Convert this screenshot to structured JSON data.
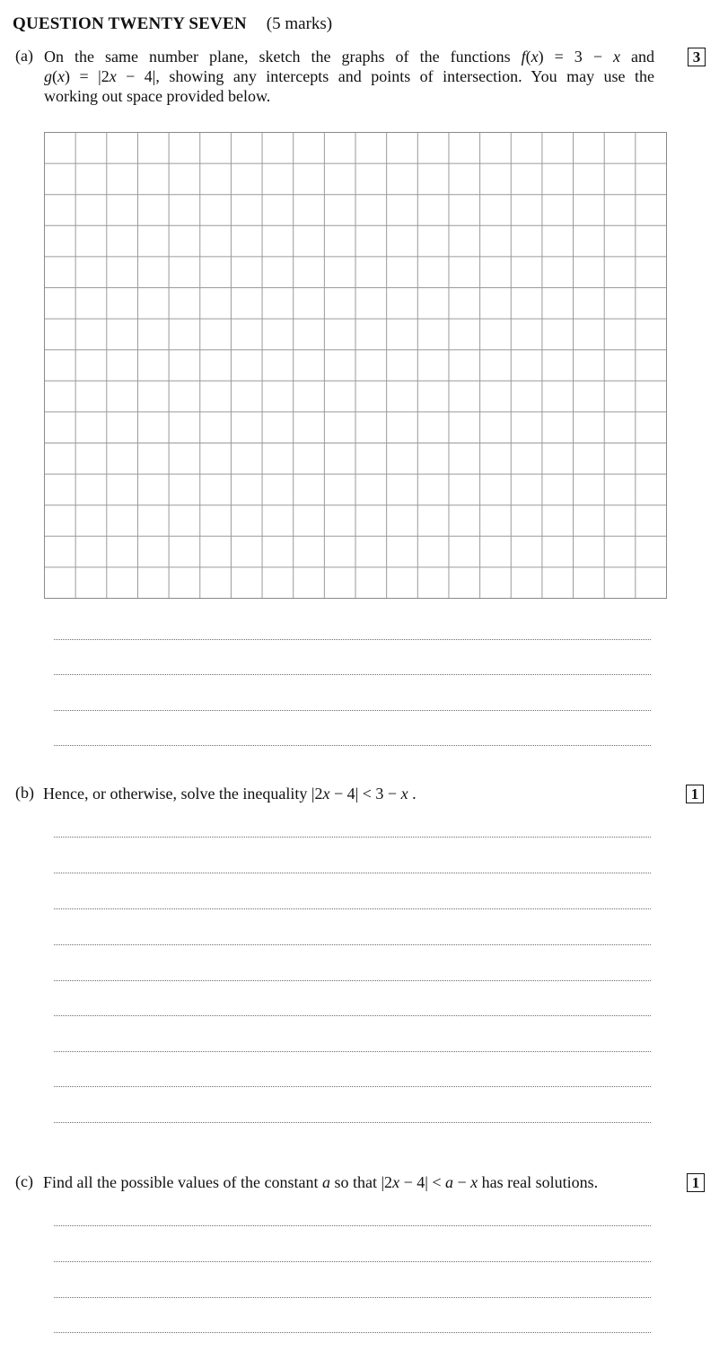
{
  "question": {
    "title": "QUESTION TWENTY SEVEN",
    "marks": "(5 marks)"
  },
  "part_a": {
    "label": "(a)",
    "line1_pre": "On the same number plane, sketch the graphs of the functions ",
    "f_name": "f",
    "f_arg": "(",
    "f_var": "x",
    "f_rest": ") = 3 − ",
    "f_var2": "x",
    "line1_post": " and",
    "g_name": "g",
    "g_open": "(",
    "g_var": "x",
    "g_mid": ") = |2",
    "g_var2": "x",
    "g_rest": " − 4|, showing any intercepts and points of intersection. You may use the",
    "line3": "working out space provided below.",
    "marks": "3",
    "grid": {
      "columns": 20,
      "rows": 15
    }
  },
  "part_b": {
    "label": "(b)",
    "text_pre": "Hence, or otherwise, solve the inequality |2",
    "var1": "x",
    "text_mid": " − 4| < 3 − ",
    "var2": "x",
    "text_post": " .",
    "marks": "1"
  },
  "part_c": {
    "label": "(c)",
    "text_pre": "Find all the possible values of the constant ",
    "var_a": "a",
    "text_mid": " so that |2",
    "var_x1": "x",
    "text_mid2": " − 4| < ",
    "var_a2": "a",
    "text_mid3": " − ",
    "var_x2": "x",
    "text_post": " has real solutions.",
    "marks": "1"
  }
}
